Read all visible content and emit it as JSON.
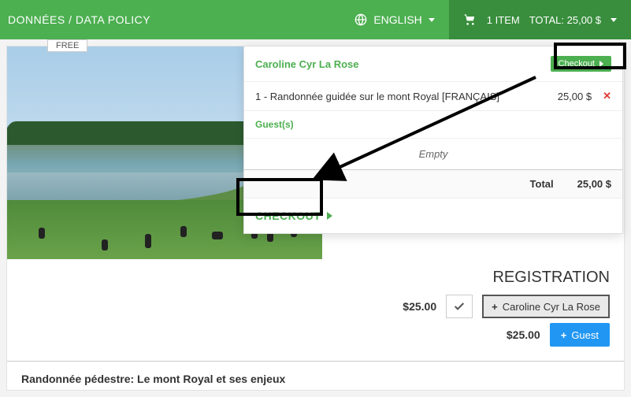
{
  "topbar": {
    "data_policy": "DONNÉES / DATA POLICY",
    "language_label": "ENGLISH"
  },
  "cart_summary": {
    "count_label": "1 ITEM",
    "total_label": "TOTAL: 25,00 $"
  },
  "cart_panel": {
    "user_name": "Caroline Cyr La Rose",
    "checkout_mini": "Checkout",
    "line_item": "1 - Randonnée guidée sur le mont Royal [FRANÇAIS]",
    "line_amount": "25,00 $",
    "guests_header": "Guest(s)",
    "empty_text": "Empty",
    "total_label": "Total",
    "total_value": "25,00 $",
    "checkout_big": "CHECKOUT"
  },
  "registration": {
    "heading": "REGISTRATION",
    "free_badge": "FREE",
    "row1_price": "$25.00",
    "row1_name_btn": "Caroline Cyr La Rose",
    "row2_price": "$25.00",
    "guest_btn": "Guest"
  },
  "event": {
    "title": "Randonnée pédestre: Le mont Royal et ses enjeux"
  }
}
